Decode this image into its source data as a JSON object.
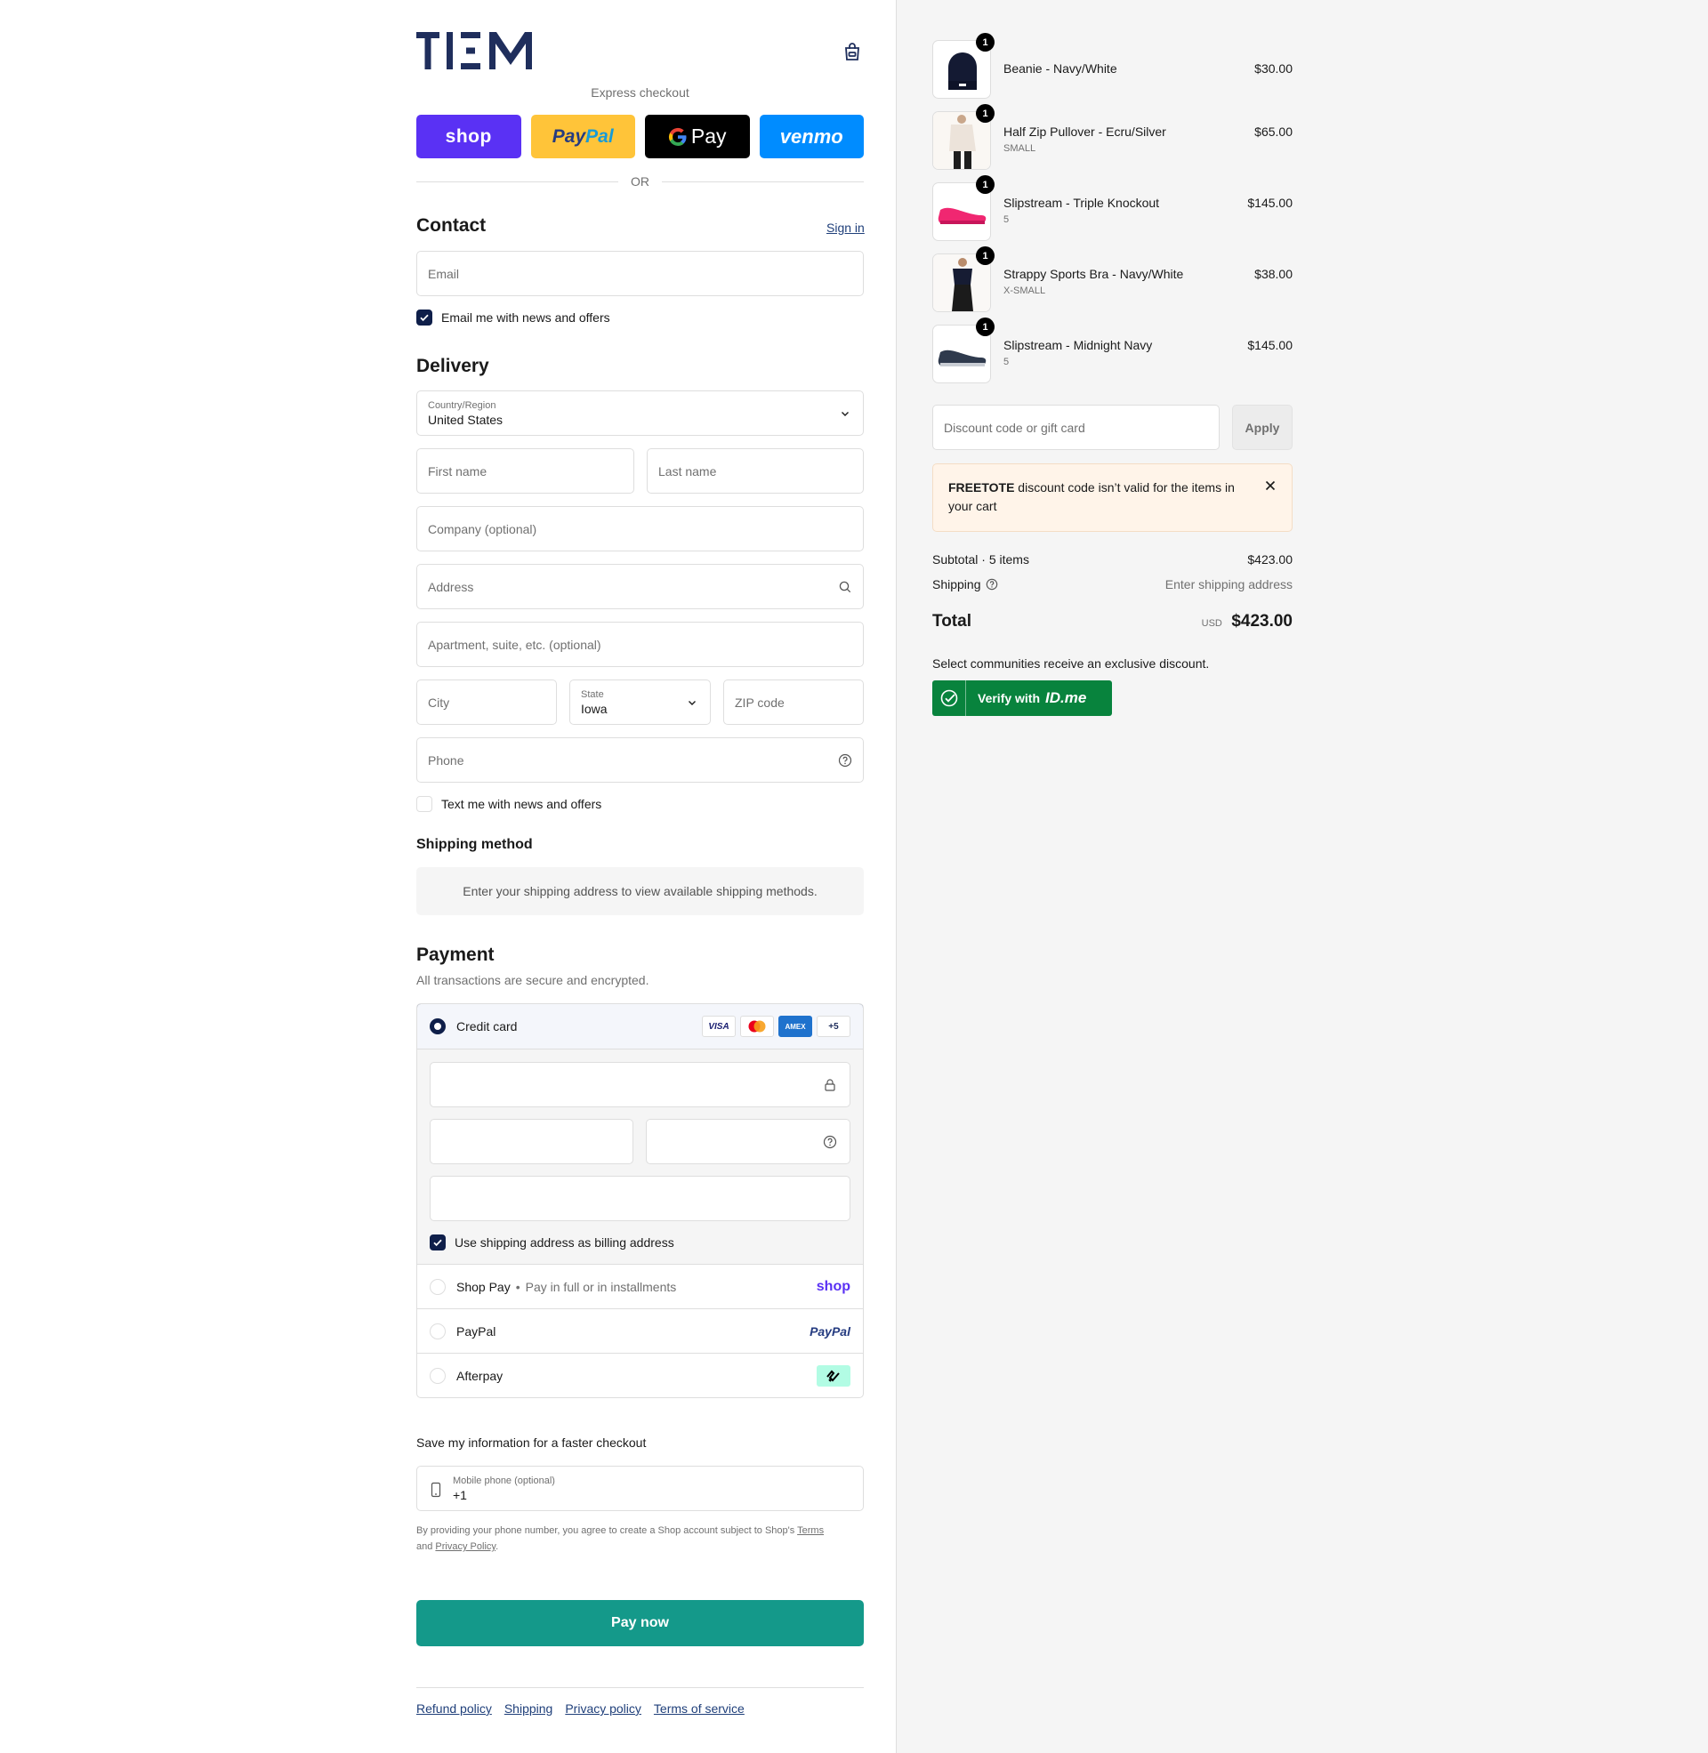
{
  "brand": {
    "logo_text": "TIEM"
  },
  "express": {
    "label": "Express checkout",
    "shop": "shop",
    "paypal": "PayPal",
    "gpay": "Pay",
    "venmo": "venmo",
    "or": "OR"
  },
  "contact": {
    "title": "Contact",
    "sign_in": "Sign in",
    "email_placeholder": "Email",
    "email_news": "Email me with news and offers"
  },
  "delivery": {
    "title": "Delivery",
    "country_label": "Country/Region",
    "country_value": "United States",
    "first_name": "First name",
    "last_name": "Last name",
    "company": "Company (optional)",
    "address": "Address",
    "apartment": "Apartment, suite, etc. (optional)",
    "city": "City",
    "state_label": "State",
    "state_value": "Iowa",
    "zip": "ZIP code",
    "phone": "Phone",
    "text_news": "Text me with news and offers"
  },
  "shipping_method": {
    "title": "Shipping method",
    "notice": "Enter your shipping address to view available shipping methods."
  },
  "payment": {
    "title": "Payment",
    "subtitle": "All transactions are secure and encrypted.",
    "credit_card": "Credit card",
    "card_logos": [
      "VISA",
      "MC",
      "AMEX",
      "+5"
    ],
    "billing_same": "Use shipping address as billing address",
    "shop_pay": "Shop Pay",
    "shop_pay_desc": "Pay in full or in installments",
    "shop_brand": "shop",
    "paypal": "PayPal",
    "paypal_brand": "PayPal",
    "afterpay": "Afterpay"
  },
  "remember": {
    "title": "Save my information for a faster checkout",
    "mobile_label": "Mobile phone (optional)",
    "mobile_value": "+1",
    "legal_1": "By providing your phone number, you agree to create a Shop account subject to Shop's ",
    "legal_terms": "Terms",
    "legal_2": "and ",
    "legal_privacy": "Privacy Policy",
    "legal_3": "."
  },
  "pay_now": "Pay now",
  "footer": [
    "Refund policy",
    "Shipping",
    "Privacy policy",
    "Terms of service"
  ],
  "cart": {
    "items": [
      {
        "qty": "1",
        "name": "Beanie - Navy/White",
        "variant": "",
        "price": "$30.00"
      },
      {
        "qty": "1",
        "name": "Half Zip Pullover - Ecru/Silver",
        "variant": "SMALL",
        "price": "$65.00"
      },
      {
        "qty": "1",
        "name": "Slipstream - Triple Knockout",
        "variant": "5",
        "price": "$145.00"
      },
      {
        "qty": "1",
        "name": "Strappy Sports Bra - Navy/White",
        "variant": "X-SMALL",
        "price": "$38.00"
      },
      {
        "qty": "1",
        "name": "Slipstream - Midnight Navy",
        "variant": "5",
        "price": "$145.00"
      }
    ],
    "discount_placeholder": "Discount code or gift card",
    "apply": "Apply",
    "alert_code": "FREETOTE",
    "alert_text": " discount code isn’t valid for the items in your cart",
    "subtotal_label": "Subtotal · 5 items",
    "subtotal_value": "$423.00",
    "shipping_label": "Shipping",
    "shipping_value": "Enter shipping address",
    "total_label": "Total",
    "currency": "USD",
    "total_value": "$423.00",
    "idme_note": "Select communities receive an exclusive discount.",
    "idme_verify": "Verify with",
    "idme_brand": "ID.me"
  },
  "colors": {
    "brand_navy": "#1f2e5c",
    "pay_now": "#14998a",
    "shop_purple": "#5a31f4",
    "paypal_yellow": "#ffc439",
    "venmo_blue": "#008cff",
    "idme_green": "#08833d"
  }
}
